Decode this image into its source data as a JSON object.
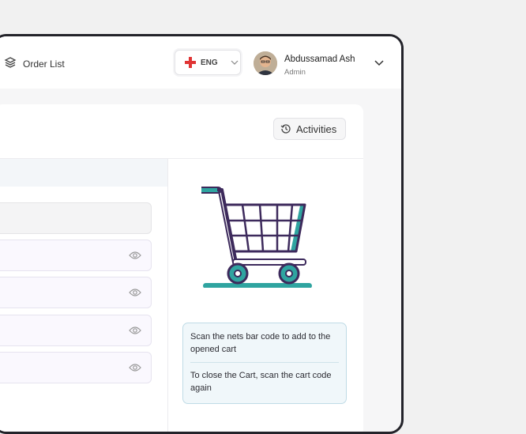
{
  "header": {
    "nav_item": "Order List",
    "language": "ENG",
    "user": {
      "name": "Abdussamad Ash",
      "role": "Admin"
    }
  },
  "main": {
    "activities_label": "Activities",
    "rows": [
      {
        "id": "head"
      },
      {
        "id": "item-1"
      },
      {
        "id": "item-2"
      },
      {
        "id": "item-3"
      },
      {
        "id": "item-4"
      }
    ],
    "notice": {
      "line1": "Scan the nets bar code to add to the opened cart",
      "line2": "To close the Cart, scan the cart code again"
    }
  },
  "colors": {
    "cart_outline": "#3d2a5c",
    "cart_accent": "#2fa4a0",
    "flag_red": "#e03434",
    "notice_border": "#bfdbe6"
  }
}
